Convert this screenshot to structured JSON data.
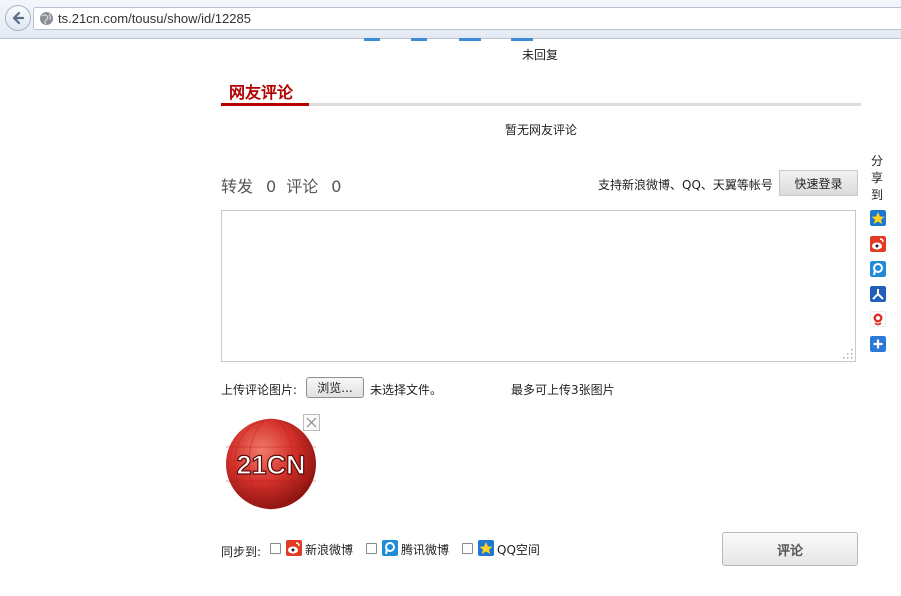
{
  "browser": {
    "url": "ts.21cn.com/tousu/show/id/12285"
  },
  "complaint": {
    "status": "未回复"
  },
  "comments": {
    "section_title": "网友评论",
    "empty_text": "暂无网友评论"
  },
  "stats": {
    "forward_label": "转发",
    "forward_count": "0",
    "comment_label": "评论",
    "comment_count": "0"
  },
  "login": {
    "support_text": "支持新浪微博、QQ、天翼等帐号",
    "button_label": "快速登录"
  },
  "upload": {
    "label": "上传评论图片:",
    "browse_label": "浏览...",
    "no_file_text": "未选择文件。",
    "limit_text": "最多可上传3张图片"
  },
  "thumbnail": {
    "logo_text": "21CN"
  },
  "sync": {
    "label": "同步到:",
    "options": [
      {
        "label": "新浪微博",
        "icon": "sina-weibo-icon",
        "checked": false
      },
      {
        "label": "腾讯微博",
        "icon": "tencent-weibo-icon",
        "checked": false
      },
      {
        "label": "QQ空间",
        "icon": "qzone-icon",
        "checked": false
      }
    ]
  },
  "submit": {
    "label": "评论"
  },
  "share": {
    "label": "分享到",
    "icons": [
      "qzone-icon",
      "sina-weibo-icon",
      "tencent-weibo-icon",
      "renren-icon",
      "sohu-icon",
      "more-icon"
    ]
  },
  "colors": {
    "accent": "#b40000",
    "link_blue": "#1f7bd6"
  }
}
